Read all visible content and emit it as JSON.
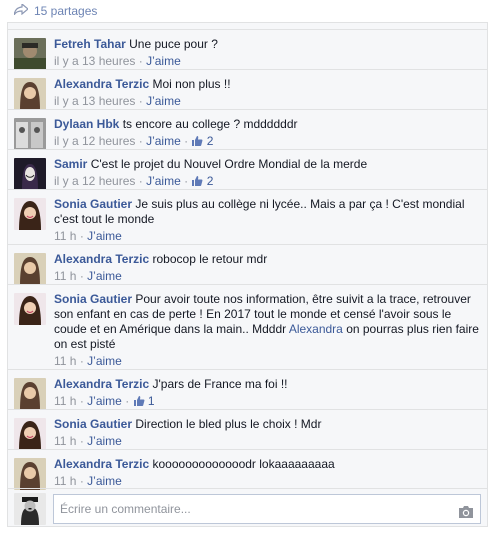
{
  "shares": {
    "label": "15 partages"
  },
  "comments": [
    {
      "author": "Fetreh Tahar",
      "text": "Une puce pour ?",
      "time": "il y a 13 heures",
      "like": "J’aime",
      "likes": ""
    },
    {
      "author": "Alexandra Terzic",
      "text": "Moi non plus !!",
      "time": "il y a 13 heures",
      "like": "J’aime",
      "likes": ""
    },
    {
      "author": "Dylaan Hbk",
      "text": "ts encore au college ? mddddddr",
      "time": "il y a 12 heures",
      "like": "J’aime",
      "likes": "2"
    },
    {
      "author": "Samir",
      "text": "C'est le projet du Nouvel Ordre Mondial de la merde",
      "time": "il y a 12 heures",
      "like": "J’aime",
      "likes": "2"
    },
    {
      "author": "Sonia Gautier",
      "text": "Je suis plus au collège ni lycée.. Mais a par ça ! C'est mondial c'est tout le monde",
      "time": "11 h",
      "like": "J’aime",
      "likes": ""
    },
    {
      "author": "Alexandra Terzic",
      "text": "robocop le retour mdr",
      "time": "11 h",
      "like": "J’aime",
      "likes": ""
    },
    {
      "author": "Sonia Gautier",
      "text": "Pour avoir toute nos information, être suivit a la trace, retrouver son enfant en cas de perte ! En 2017 tout le monde et censé l'avoir sous le coude et en Amérique dans la main.. Mdddr",
      "mention": "Alexandra",
      "text_after": " on pourras plus rien faire on est pisté",
      "time": "11 h",
      "like": "J’aime",
      "likes": ""
    },
    {
      "author": "Alexandra Terzic",
      "text": "J'pars de France ma foi !!",
      "time": "11 h",
      "like": "J’aime",
      "likes": "1"
    },
    {
      "author": "Sonia Gautier",
      "text": "Direction le bled plus le choix ! Mdr",
      "time": "11 h",
      "like": "J’aime",
      "likes": ""
    },
    {
      "author": "Alexandra Terzic",
      "text": "kooooooooooooodr lokaaaaaaaaa",
      "time": "11 h",
      "like": "J’aime",
      "likes": ""
    }
  ],
  "composer": {
    "placeholder": "Écrire un commentaire..."
  },
  "colors": {
    "link": "#3b5998",
    "meta": "#90949c",
    "panel": "#f6f7f9",
    "border": "#e1e2e3"
  },
  "icons": {
    "share": "share-arrow-icon",
    "like": "thumbs-up-icon",
    "camera": "camera-icon"
  }
}
